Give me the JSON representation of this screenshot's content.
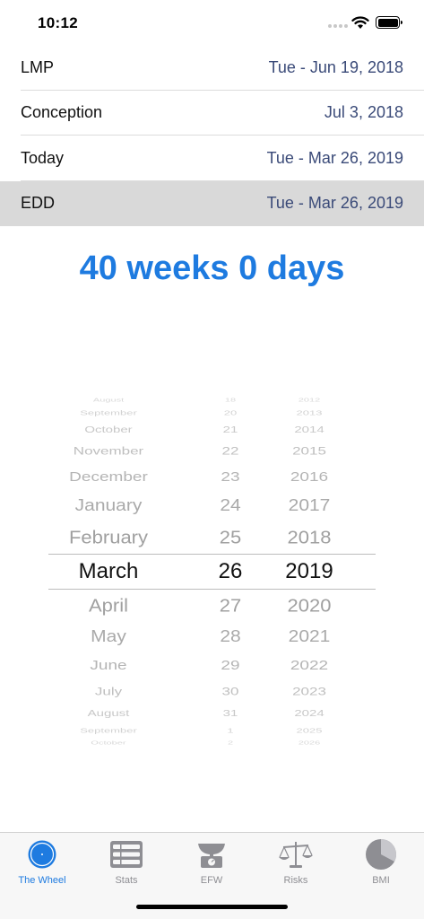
{
  "status_bar": {
    "time": "10:12"
  },
  "rows": [
    {
      "label": "LMP",
      "value": "Tue - Jun 19, 2018",
      "selected": false
    },
    {
      "label": "Conception",
      "value": "Jul 3, 2018",
      "selected": false
    },
    {
      "label": "Today",
      "value": "Tue - Mar 26, 2019",
      "selected": false
    },
    {
      "label": "EDD",
      "value": "Tue - Mar 26, 2019",
      "selected": true
    }
  ],
  "gestation": "40 weeks 0 days",
  "picker": {
    "selected": {
      "month": "March",
      "day": "26",
      "year": "2019"
    },
    "months": [
      "August",
      "September",
      "October",
      "November",
      "December",
      "January",
      "February",
      "March",
      "April",
      "May",
      "June",
      "July",
      "August",
      "September",
      "October"
    ],
    "days": [
      "18",
      "20",
      "21",
      "22",
      "23",
      "24",
      "25",
      "26",
      "27",
      "28",
      "29",
      "30",
      "31",
      "1",
      "2"
    ],
    "years": [
      "2012",
      "2013",
      "2014",
      "2015",
      "2016",
      "2017",
      "2018",
      "2019",
      "2020",
      "2021",
      "2022",
      "2023",
      "2024",
      "2025",
      "2026"
    ]
  },
  "tabs": [
    {
      "label": "The Wheel",
      "icon": "wheel-icon",
      "active": true
    },
    {
      "label": "Stats",
      "icon": "stats-icon",
      "active": false
    },
    {
      "label": "EFW",
      "icon": "scale-icon",
      "active": false
    },
    {
      "label": "Risks",
      "icon": "balance-icon",
      "active": false
    },
    {
      "label": "BMI",
      "icon": "pie-icon",
      "active": false
    }
  ],
  "colors": {
    "accent": "#1e7be0",
    "value_text": "#3a4a78",
    "selected_row": "#d9d9d9"
  }
}
